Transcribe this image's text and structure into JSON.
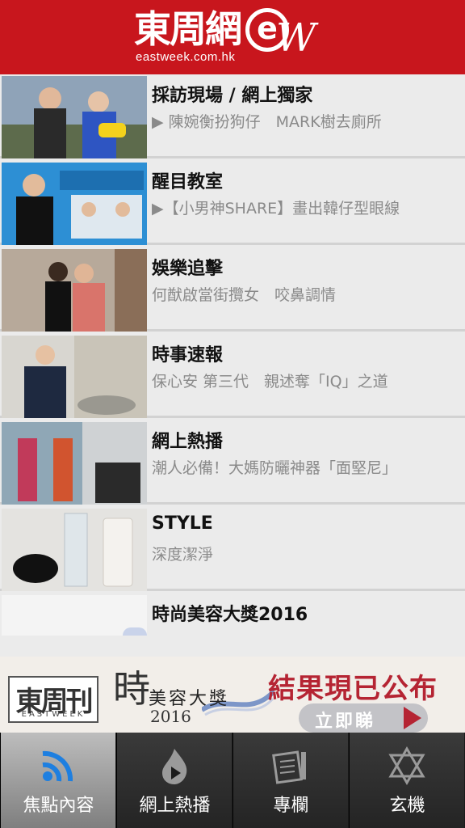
{
  "header": {
    "logo_cn": "東周網",
    "logo_e": "e",
    "logo_w": "W",
    "logo_url": "eastweek.com.hk"
  },
  "news": [
    {
      "title": "採訪現場 / 網上獨家",
      "subtitle": "▶ 陳婉衡扮狗仔　MARK樹去廁所"
    },
    {
      "title": "醒目教室",
      "subtitle": "▶【小男神SHARE】畫出韓仔型眼線"
    },
    {
      "title": "娛樂追擊",
      "subtitle": "何猷啟當街攬女　咬鼻調情"
    },
    {
      "title": "時事速報",
      "subtitle": "保心安 第三代　親述奪「IQ」之道"
    },
    {
      "title": "網上熱播",
      "subtitle": "潮人必備！大媽防曬神器「面堅尼」"
    },
    {
      "title": "STYLE",
      "subtitle": "深度潔淨"
    },
    {
      "title": "時尚美容大獎2016",
      "subtitle": ""
    }
  ],
  "banner": {
    "logo_cn": "東周刊",
    "logo_en": "EASTWEEK",
    "shi": "時",
    "title": "美容大獎",
    "year": "2016",
    "result": "結果現已公布",
    "button": "立即睇"
  },
  "tabs": [
    {
      "label": "焦點內容",
      "icon": "wifi-icon"
    },
    {
      "label": "網上熱播",
      "icon": "flame-play-icon"
    },
    {
      "label": "專欄",
      "icon": "notebook-pen-icon"
    },
    {
      "label": "玄機",
      "icon": "star-of-david-icon"
    }
  ],
  "colors": {
    "header_red": "#c8161d",
    "accent_red": "#b52433",
    "list_bg": "#ebebeb",
    "tabbar_bg": "#1b1b1b"
  }
}
